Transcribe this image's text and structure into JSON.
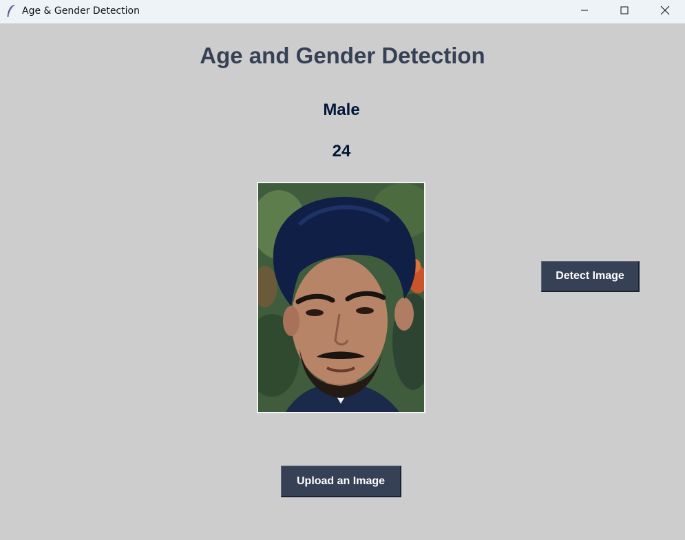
{
  "window": {
    "title": "Age & Gender Detection",
    "icon": "feather-icon"
  },
  "controls": {
    "minimize_icon": "minimize-icon",
    "maximize_icon": "maximize-icon",
    "close_icon": "close-icon"
  },
  "main": {
    "heading": "Age and Gender Detection",
    "gender_result": "Male",
    "age_result": "24",
    "detect_button_label": "Detect Image",
    "upload_button_label": "Upload an Image"
  },
  "colors": {
    "background": "#cdcdcd",
    "heading": "#364156",
    "result_text": "#011638",
    "button_bg": "#364156",
    "button_text": "#ffffff"
  }
}
